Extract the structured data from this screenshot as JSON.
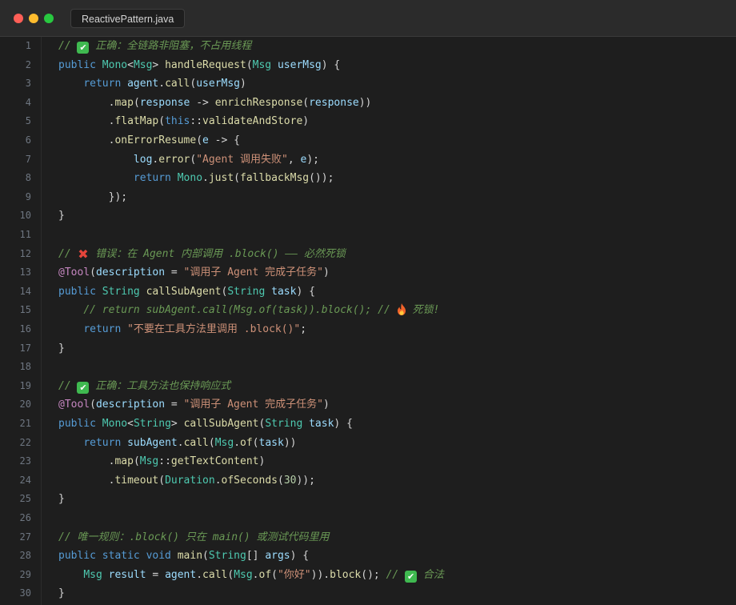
{
  "tab": {
    "label": "ReactivePattern.java"
  },
  "lines": [
    {
      "n": "1",
      "tokens": [
        [
          "cmt",
          "// "
        ],
        [
          "check",
          ""
        ],
        [
          "cmt",
          " 正确：全链路非阻塞，不占用线程"
        ]
      ]
    },
    {
      "n": "2",
      "tokens": [
        [
          "kw",
          "public "
        ],
        [
          "type",
          "Mono"
        ],
        [
          "punc",
          "<"
        ],
        [
          "type",
          "Msg"
        ],
        [
          "punc",
          "> "
        ],
        [
          "fn",
          "handleRequest"
        ],
        [
          "punc",
          "("
        ],
        [
          "type",
          "Msg "
        ],
        [
          "var",
          "userMsg"
        ],
        [
          "punc",
          ") {"
        ]
      ]
    },
    {
      "n": "3",
      "tokens": [
        [
          "punc",
          "    "
        ],
        [
          "kw",
          "return "
        ],
        [
          "var",
          "agent"
        ],
        [
          "punc",
          "."
        ],
        [
          "fn",
          "call"
        ],
        [
          "punc",
          "("
        ],
        [
          "var",
          "userMsg"
        ],
        [
          "punc",
          ")"
        ]
      ]
    },
    {
      "n": "4",
      "tokens": [
        [
          "punc",
          "        ."
        ],
        [
          "fn",
          "map"
        ],
        [
          "punc",
          "("
        ],
        [
          "var",
          "response"
        ],
        [
          "punc",
          " -> "
        ],
        [
          "fn",
          "enrichResponse"
        ],
        [
          "punc",
          "("
        ],
        [
          "var",
          "response"
        ],
        [
          "punc",
          "))"
        ]
      ]
    },
    {
      "n": "5",
      "tokens": [
        [
          "punc",
          "        ."
        ],
        [
          "fn",
          "flatMap"
        ],
        [
          "punc",
          "("
        ],
        [
          "kw",
          "this"
        ],
        [
          "punc",
          "::"
        ],
        [
          "fn",
          "validateAndStore"
        ],
        [
          "punc",
          ")"
        ]
      ]
    },
    {
      "n": "6",
      "tokens": [
        [
          "punc",
          "        ."
        ],
        [
          "fn",
          "onErrorResume"
        ],
        [
          "punc",
          "("
        ],
        [
          "var",
          "e"
        ],
        [
          "punc",
          " -> {"
        ]
      ]
    },
    {
      "n": "7",
      "tokens": [
        [
          "punc",
          "            "
        ],
        [
          "var",
          "log"
        ],
        [
          "punc",
          "."
        ],
        [
          "fn",
          "error"
        ],
        [
          "punc",
          "("
        ],
        [
          "str",
          "\"Agent 调用失败\""
        ],
        [
          "punc",
          ", "
        ],
        [
          "var",
          "e"
        ],
        [
          "punc",
          ");"
        ]
      ]
    },
    {
      "n": "8",
      "tokens": [
        [
          "punc",
          "            "
        ],
        [
          "kw",
          "return "
        ],
        [
          "type",
          "Mono"
        ],
        [
          "punc",
          "."
        ],
        [
          "fn",
          "just"
        ],
        [
          "punc",
          "("
        ],
        [
          "fn",
          "fallbackMsg"
        ],
        [
          "punc",
          "());"
        ]
      ]
    },
    {
      "n": "9",
      "tokens": [
        [
          "punc",
          "        });"
        ]
      ]
    },
    {
      "n": "10",
      "tokens": [
        [
          "punc",
          "}"
        ]
      ]
    },
    {
      "n": "11",
      "tokens": []
    },
    {
      "n": "12",
      "tokens": [
        [
          "cmt",
          "// "
        ],
        [
          "cross",
          ""
        ],
        [
          "cmt",
          " 错误：在 Agent 内部调用 .block() —— 必然死锁"
        ]
      ]
    },
    {
      "n": "13",
      "tokens": [
        [
          "ann",
          "@Tool"
        ],
        [
          "punc",
          "("
        ],
        [
          "var",
          "description"
        ],
        [
          "punc",
          " = "
        ],
        [
          "str",
          "\"调用子 Agent 完成子任务\""
        ],
        [
          "punc",
          ")"
        ]
      ]
    },
    {
      "n": "14",
      "tokens": [
        [
          "kw",
          "public "
        ],
        [
          "type",
          "String "
        ],
        [
          "fn",
          "callSubAgent"
        ],
        [
          "punc",
          "("
        ],
        [
          "type",
          "String "
        ],
        [
          "var",
          "task"
        ],
        [
          "punc",
          ") {"
        ]
      ]
    },
    {
      "n": "15",
      "tokens": [
        [
          "punc",
          "    "
        ],
        [
          "cmt",
          "// return subAgent.call(Msg.of(task)).block(); // "
        ],
        [
          "fire",
          ""
        ],
        [
          "cmt",
          " 死锁!"
        ]
      ]
    },
    {
      "n": "16",
      "tokens": [
        [
          "punc",
          "    "
        ],
        [
          "kw",
          "return "
        ],
        [
          "str",
          "\"不要在工具方法里调用 .block()\""
        ],
        [
          "punc",
          ";"
        ]
      ]
    },
    {
      "n": "17",
      "tokens": [
        [
          "punc",
          "}"
        ]
      ]
    },
    {
      "n": "18",
      "tokens": []
    },
    {
      "n": "19",
      "tokens": [
        [
          "cmt",
          "// "
        ],
        [
          "check",
          ""
        ],
        [
          "cmt",
          " 正确：工具方法也保持响应式"
        ]
      ]
    },
    {
      "n": "20",
      "tokens": [
        [
          "ann",
          "@Tool"
        ],
        [
          "punc",
          "("
        ],
        [
          "var",
          "description"
        ],
        [
          "punc",
          " = "
        ],
        [
          "str",
          "\"调用子 Agent 完成子任务\""
        ],
        [
          "punc",
          ")"
        ]
      ]
    },
    {
      "n": "21",
      "tokens": [
        [
          "kw",
          "public "
        ],
        [
          "type",
          "Mono"
        ],
        [
          "punc",
          "<"
        ],
        [
          "type",
          "String"
        ],
        [
          "punc",
          "> "
        ],
        [
          "fn",
          "callSubAgent"
        ],
        [
          "punc",
          "("
        ],
        [
          "type",
          "String "
        ],
        [
          "var",
          "task"
        ],
        [
          "punc",
          ") {"
        ]
      ]
    },
    {
      "n": "22",
      "tokens": [
        [
          "punc",
          "    "
        ],
        [
          "kw",
          "return "
        ],
        [
          "var",
          "subAgent"
        ],
        [
          "punc",
          "."
        ],
        [
          "fn",
          "call"
        ],
        [
          "punc",
          "("
        ],
        [
          "type",
          "Msg"
        ],
        [
          "punc",
          "."
        ],
        [
          "fn",
          "of"
        ],
        [
          "punc",
          "("
        ],
        [
          "var",
          "task"
        ],
        [
          "punc",
          "))"
        ]
      ]
    },
    {
      "n": "23",
      "tokens": [
        [
          "punc",
          "        ."
        ],
        [
          "fn",
          "map"
        ],
        [
          "punc",
          "("
        ],
        [
          "type",
          "Msg"
        ],
        [
          "punc",
          "::"
        ],
        [
          "fn",
          "getTextContent"
        ],
        [
          "punc",
          ")"
        ]
      ]
    },
    {
      "n": "24",
      "tokens": [
        [
          "punc",
          "        ."
        ],
        [
          "fn",
          "timeout"
        ],
        [
          "punc",
          "("
        ],
        [
          "type",
          "Duration"
        ],
        [
          "punc",
          "."
        ],
        [
          "fn",
          "ofSeconds"
        ],
        [
          "punc",
          "("
        ],
        [
          "num",
          "30"
        ],
        [
          "punc",
          "));"
        ]
      ]
    },
    {
      "n": "25",
      "tokens": [
        [
          "punc",
          "}"
        ]
      ]
    },
    {
      "n": "26",
      "tokens": []
    },
    {
      "n": "27",
      "tokens": [
        [
          "cmt",
          "// 唯一规则：.block() 只在 main() 或测试代码里用"
        ]
      ]
    },
    {
      "n": "28",
      "tokens": [
        [
          "kw",
          "public static void "
        ],
        [
          "fn",
          "main"
        ],
        [
          "punc",
          "("
        ],
        [
          "type",
          "String"
        ],
        [
          "punc",
          "[] "
        ],
        [
          "var",
          "args"
        ],
        [
          "punc",
          ") {"
        ]
      ]
    },
    {
      "n": "29",
      "tokens": [
        [
          "punc",
          "    "
        ],
        [
          "type",
          "Msg "
        ],
        [
          "var",
          "result"
        ],
        [
          "punc",
          " = "
        ],
        [
          "var",
          "agent"
        ],
        [
          "punc",
          "."
        ],
        [
          "fn",
          "call"
        ],
        [
          "punc",
          "("
        ],
        [
          "type",
          "Msg"
        ],
        [
          "punc",
          "."
        ],
        [
          "fn",
          "of"
        ],
        [
          "punc",
          "("
        ],
        [
          "str",
          "\"你好\""
        ],
        [
          "punc",
          "))."
        ],
        [
          "fn",
          "block"
        ],
        [
          "punc",
          "(); "
        ],
        [
          "cmt",
          "// "
        ],
        [
          "check",
          ""
        ],
        [
          "cmt",
          " 合法"
        ]
      ]
    },
    {
      "n": "30",
      "tokens": [
        [
          "punc",
          "}"
        ]
      ]
    }
  ]
}
